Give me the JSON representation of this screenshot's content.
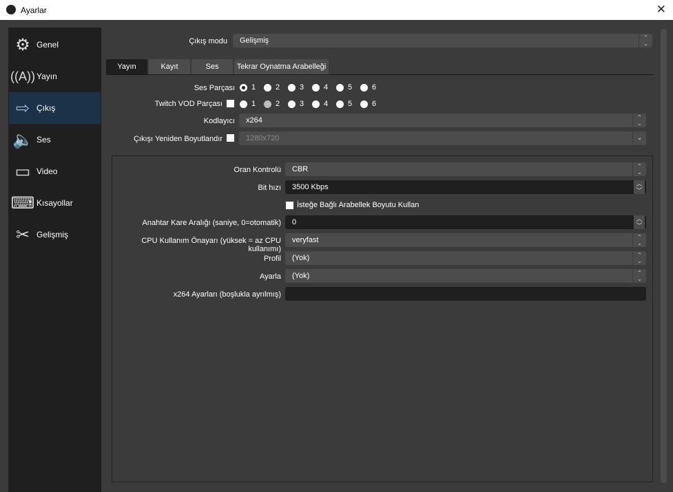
{
  "window": {
    "title": "Ayarlar"
  },
  "sidebar": {
    "items": [
      {
        "label": "Genel",
        "icon": "gear-icon"
      },
      {
        "label": "Yayın",
        "icon": "broadcast-icon"
      },
      {
        "label": "Çıkış",
        "icon": "output-icon",
        "selected": true
      },
      {
        "label": "Ses",
        "icon": "speaker-icon"
      },
      {
        "label": "Video",
        "icon": "monitor-icon"
      },
      {
        "label": "Kısayollar",
        "icon": "keyboard-icon"
      },
      {
        "label": "Gelişmiş",
        "icon": "tools-icon"
      }
    ]
  },
  "output_mode": {
    "label": "Çıkış modu",
    "value": "Gelişmiş"
  },
  "tabs": [
    "Yayın",
    "Kayıt",
    "Ses",
    "Tekrar Oynatma Arabelleği"
  ],
  "audio_track": {
    "label": "Ses Parçası",
    "options": [
      "1",
      "2",
      "3",
      "4",
      "5",
      "6"
    ],
    "selected": "1"
  },
  "twitch_vod": {
    "label": "Twitch VOD Parçası",
    "checked": false,
    "options": [
      "1",
      "2",
      "3",
      "4",
      "5",
      "6"
    ]
  },
  "encoder": {
    "label": "Kodlayıcı",
    "value": "x264"
  },
  "rescale": {
    "label": "Çıkışı Yeniden Boyutlandır",
    "checked": false,
    "value": "1280x720"
  },
  "rate_control": {
    "label": "Oran Kontrolü",
    "value": "CBR"
  },
  "bitrate": {
    "label": "Bit hızı",
    "value": "3500 Kbps"
  },
  "custom_buffer": {
    "label": "İsteğe Bağlı Arabellek Boyutu Kullan",
    "checked": false
  },
  "keyframe": {
    "label": "Anahtar Kare Aralığı (saniye, 0=otomatik)",
    "value": "0"
  },
  "cpu_preset": {
    "label": "CPU Kullanım Önayarı (yüksek = az CPU kullanımı)",
    "value": "veryfast"
  },
  "profile": {
    "label": "Profil",
    "value": "(Yok)"
  },
  "tune": {
    "label": "Ayarla",
    "value": "(Yok)"
  },
  "x264_opts": {
    "label": "x264 Ayarları (boşlukla ayrılmış)",
    "value": ""
  }
}
